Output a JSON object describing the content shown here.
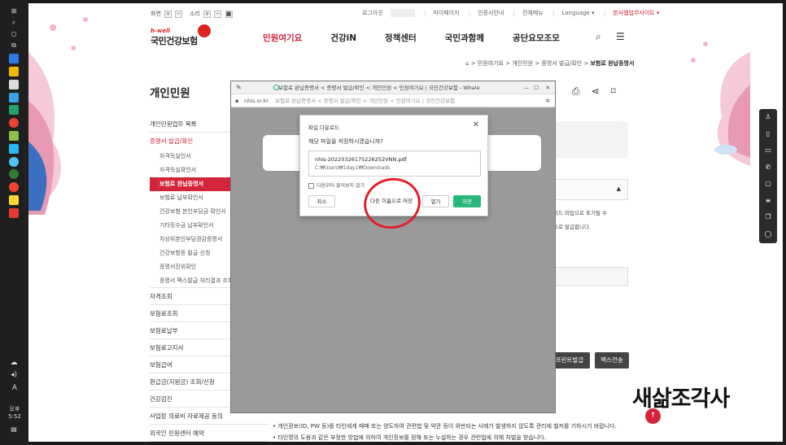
{
  "taskbar": {
    "clock": "오후 5:52",
    "lang": "A"
  },
  "util": {
    "zoom_label": "화면",
    "zoom_plus": "+",
    "zoom_minus": "−",
    "sound_label": "소리",
    "sound_plus": "+",
    "sound_minus": "−",
    "sound_stop": "■"
  },
  "top_links": {
    "logout": "로그아웃",
    "mypage": "마이페이지",
    "cert": "인증서안내",
    "sitemap": "전체메뉴",
    "language": "Language ▾",
    "portal": "본사웹업무사이트 ▾"
  },
  "logo": {
    "en": "h-well",
    "ko": "국민건강보험"
  },
  "gnb": {
    "items": [
      "민원여기요",
      "건강iN",
      "정책센터",
      "국민과함께",
      "공단요모조모"
    ]
  },
  "breadcrumb": {
    "home": "⌂",
    "c1": "민원여기요",
    "c2": "개인민원",
    "c3": "증명서 발급/확인",
    "current": "보험료 완납증명서",
    "sep": ">"
  },
  "page_title": "개인민원",
  "lnb": {
    "top": "개인민원업무 목록",
    "group": "증명서 발급/확인",
    "subs": [
      "자격득실인서",
      "자격득실확인서",
      "보험료 완납증명서",
      "보험료 납부확인서",
      "건강보험 본인부담금 확인서",
      "기타징수금 납부확인서",
      "차상위본인부담경감증명서",
      "건강보험증 발급 신청",
      "증명서진위확인",
      "증명서 팩스발급 처리결과 조회"
    ],
    "items": [
      "자격조회",
      "보험료조회",
      "보험료납부",
      "보험료고지서",
      "보험급여",
      "환급금(지원금) 조회/신청",
      "건강검진",
      "사업장 의료비 자료제공 동의",
      "외국인 민원센터 예약"
    ]
  },
  "right": {
    "text1": "리드 미입으로 표기될 수",
    "text2": "으로 발급합니다.",
    "arrow": "▲"
  },
  "buttons": {
    "print": "프린트발급",
    "fax": "팩스전송"
  },
  "notice": {
    "line1": "• 개인정보(ID, PW 등)를 타인에게 매매 또는 양도하여 관련법 및 약관 등이 위반되는 사례가 발생하지 않도록 관리에 철저를 기하시기 바랍니다.",
    "line2": "• 타인명의 도용과 같은 부정한 방법에 의하여 개인정보를 정해 또는 누설하는 경우 관련법에 의해 처벌을 받습니다."
  },
  "browser": {
    "title": "보험료 완납증명서 < 증명서 발급/확인 < 개인민원 < 민원여기요 | 국민건강보험 - Whale",
    "url_host": "nhis.or.kr",
    "url_path": "보험료 완납증명서 < 증명서 발급/확인 < 개인민원 < 민원여기요 | 국민건강보험"
  },
  "dialog": {
    "title": "파일 다운로드",
    "question": "해당 파일을 저장하시겠습니까?",
    "filename": "nhis-20220326175226252VNN.pdf",
    "path": "C:₩Users₩1day1₩Downloads",
    "checkbox": "다음부터 물어보지 않기",
    "cancel": "취소",
    "save_as": "다른 이름으로 저장",
    "open": "열기",
    "save": "저장",
    "close": "✕"
  },
  "signature": "새삶조각사",
  "top_button": "↑"
}
